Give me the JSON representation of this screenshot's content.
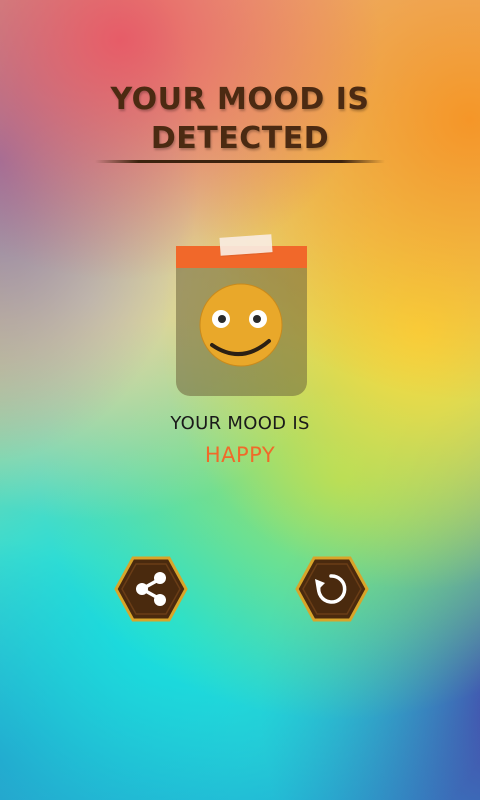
{
  "header": {
    "title_line1": "YOUR MOOD IS",
    "title_line2": "DETECTED"
  },
  "result": {
    "label": "YOUR MOOD IS",
    "mood": "HAPPY"
  },
  "mood_card": {
    "icon": "happy-smiley-icon"
  },
  "actions": {
    "share_icon": "share-icon",
    "replay_icon": "replay-icon"
  },
  "colors": {
    "title": "#4b2a12",
    "mood_value": "#f06a2a",
    "card_band": "#f1682a",
    "button_fill": "#4a2a0e",
    "button_border": "#d8a52a",
    "smiley_face": "#e9a82a"
  }
}
